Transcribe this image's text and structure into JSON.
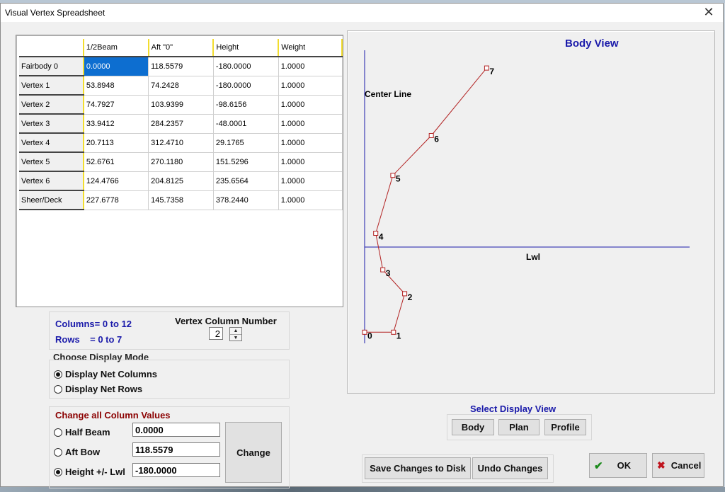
{
  "window": {
    "title": "Visual Vertex Spreadsheet",
    "close_glyph": "✕"
  },
  "grid": {
    "headers": [
      "",
      "1/2Beam",
      "Aft \"0\"",
      "Height",
      "Weight"
    ],
    "rows": [
      {
        "label": "Fairbody 0",
        "cells": [
          "0.0000",
          "118.5579",
          "-180.0000",
          "1.0000"
        ]
      },
      {
        "label": "Vertex 1",
        "cells": [
          "53.8948",
          "74.2428",
          "-180.0000",
          "1.0000"
        ]
      },
      {
        "label": "Vertex 2",
        "cells": [
          "74.7927",
          "103.9399",
          "-98.6156",
          "1.0000"
        ]
      },
      {
        "label": "Vertex 3",
        "cells": [
          "33.9412",
          "284.2357",
          "-48.0001",
          "1.0000"
        ]
      },
      {
        "label": "Vertex 4",
        "cells": [
          "20.7113",
          "312.4710",
          "29.1765",
          "1.0000"
        ]
      },
      {
        "label": "Vertex 5",
        "cells": [
          "52.6761",
          "270.1180",
          "151.5296",
          "1.0000"
        ]
      },
      {
        "label": "Vertex 6",
        "cells": [
          "124.4766",
          "204.8125",
          "235.6564",
          "1.0000"
        ]
      },
      {
        "label": "Sheer/Deck",
        "cells": [
          "227.6778",
          "145.7358",
          "378.2440",
          "1.0000"
        ]
      }
    ],
    "selected": {
      "row": 0,
      "col": 0
    }
  },
  "info": {
    "columns": "Columns= 0 to 12",
    "rows": "Rows    = 0 to 7",
    "vertex_column_label": "Vertex Column Number",
    "vertex_column_value": "2"
  },
  "display_mode": {
    "title": "Choose Display Mode",
    "options": [
      {
        "label": "Display Net Columns",
        "selected": true
      },
      {
        "label": "Display Net Rows",
        "selected": false
      }
    ]
  },
  "change_values": {
    "title": "Change all Column Values",
    "options": [
      {
        "label": "Half Beam",
        "value": "0.0000",
        "selected": false
      },
      {
        "label": "Aft Bow",
        "value": "118.5579",
        "selected": false
      },
      {
        "label": "Height +/- Lwl",
        "value": "-180.0000",
        "selected": true
      }
    ],
    "button": "Change"
  },
  "body_view": {
    "title": "Body View",
    "center_line_label": "Center Line",
    "lwl_label": "Lwl",
    "point_labels": [
      "0",
      "1",
      "2",
      "3",
      "4",
      "5",
      "6",
      "7"
    ],
    "line_color": "#b22222",
    "axis_color": "#1a1aaa"
  },
  "select_view": {
    "title": "Select Display View",
    "buttons": [
      "Body",
      "Plan",
      "Profile"
    ]
  },
  "actions": {
    "save": "Save Changes to Disk",
    "undo": "Undo Changes",
    "ok": "OK",
    "cancel": "Cancel"
  }
}
